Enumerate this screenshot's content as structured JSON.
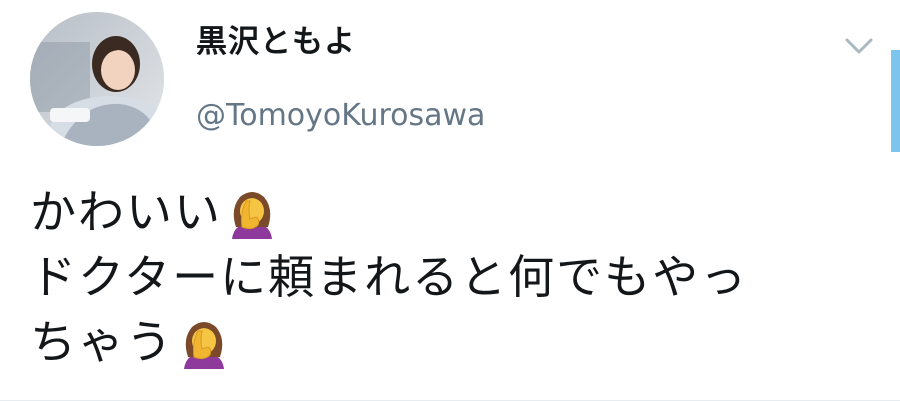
{
  "author": {
    "display_name": "黒沢ともよ",
    "handle": "@TomoyoKurosawa",
    "avatar_icon": "profile-photo-avatar"
  },
  "tweet": {
    "lines": [
      "かわいい",
      "ドクターに頼まれると何でもやっ",
      "ちゃう"
    ],
    "emoji_icon": "woman-facepalming-emoji"
  },
  "controls": {
    "menu_icon": "chevron-down-icon"
  },
  "colors": {
    "name": "#14171a",
    "handle": "#657786",
    "accent": "#7dc5ee"
  }
}
